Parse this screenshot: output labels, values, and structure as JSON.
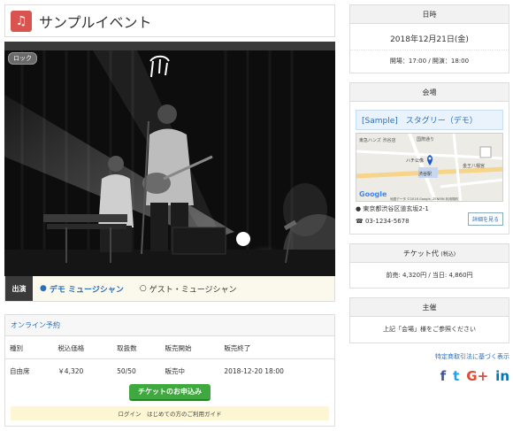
{
  "event": {
    "title": "サンプルイベント",
    "icon": "music-note-icon",
    "genre_badge": "ロック"
  },
  "performers": {
    "label": "出演",
    "items": [
      {
        "name": "デモ ミュージシャン",
        "icon": "person-icon"
      },
      {
        "name": "ゲスト・ミュージシャン",
        "icon": "person-outline-icon"
      }
    ]
  },
  "booking": {
    "title": "オンライン予約",
    "columns": [
      "種別",
      "税込価格",
      "取扱数",
      "販売開始",
      "販売終了"
    ],
    "rows": [
      {
        "type": "自由席",
        "price": "￥4,320",
        "stock": "50/50",
        "start": "販売中",
        "end": "2018-12-20 18:00"
      }
    ],
    "apply_label": "チケットのお申込み",
    "help_text": "ログイン　はじめての方のご利用ガイド"
  },
  "schedule": {
    "heading": "日時",
    "date": "2018年12月21日(金)",
    "times": "開場：17:00 / 開演：18:00"
  },
  "venue": {
    "heading": "会場",
    "name": "[Sample]　スタグリー（デモ）",
    "address": "東京都渋谷区道玄坂2-1",
    "phone": "03-1234-5678",
    "detail_label": "詳細を見る",
    "map_labels": [
      "東急ハンズ 渋谷店",
      "国際通り",
      "ハチ公像",
      "渋谷駅",
      "金王八幡宮",
      "Google",
      "地図データ ©2018 Google, ZENRIN  利用規約"
    ]
  },
  "ticket_price": {
    "heading": "チケット代",
    "heading_note": "(税込)",
    "text": "前売: 4,320円 / 当日: 4,860円"
  },
  "organizer": {
    "heading": "主催",
    "text": "上記「会場」様をご参照ください"
  },
  "footer": {
    "legal_link": "特定商取引法に基づく表示",
    "social": [
      "f",
      "t",
      "G+",
      "in"
    ]
  },
  "colors": {
    "accent": "#2a6ebb",
    "icon_bg": "#d9534f",
    "button": "#3fa93f"
  }
}
